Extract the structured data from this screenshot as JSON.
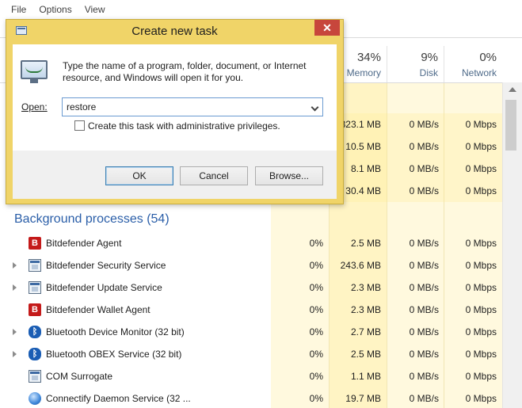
{
  "menubar": {
    "items": [
      "File",
      "Options",
      "View"
    ]
  },
  "columns": {
    "memory": {
      "percent": "34%",
      "label": "Memory"
    },
    "disk": {
      "percent": "9%",
      "label": "Disk"
    },
    "network": {
      "percent": "0%",
      "label": "Network"
    }
  },
  "app_rows": [
    {
      "memory": "323.1 MB",
      "disk": "0 MB/s",
      "network": "0 Mbps"
    },
    {
      "memory": "10.5 MB",
      "disk": "0 MB/s",
      "network": "0 Mbps"
    },
    {
      "memory": "8.1 MB",
      "disk": "0 MB/s",
      "network": "0 Mbps"
    },
    {
      "memory": "30.4 MB",
      "disk": "0 MB/s",
      "network": "0 Mbps"
    }
  ],
  "background": {
    "title": "Background processes (54)",
    "processes": [
      {
        "name": "Bitdefender Agent",
        "icon": "bitdefender-icon",
        "expandable": false,
        "cpu": "0%",
        "memory": "2.5 MB",
        "disk": "0 MB/s",
        "network": "0 Mbps"
      },
      {
        "name": "Bitdefender Security Service",
        "icon": "service-window-icon",
        "expandable": true,
        "cpu": "0%",
        "memory": "243.6 MB",
        "disk": "0 MB/s",
        "network": "0 Mbps"
      },
      {
        "name": "Bitdefender Update Service",
        "icon": "service-window-icon",
        "expandable": true,
        "cpu": "0%",
        "memory": "2.3 MB",
        "disk": "0 MB/s",
        "network": "0 Mbps"
      },
      {
        "name": "Bitdefender Wallet Agent",
        "icon": "bitdefender-icon",
        "expandable": false,
        "cpu": "0%",
        "memory": "2.3 MB",
        "disk": "0 MB/s",
        "network": "0 Mbps"
      },
      {
        "name": "Bluetooth Device Monitor (32 bit)",
        "icon": "bluetooth-icon",
        "expandable": true,
        "cpu": "0%",
        "memory": "2.7 MB",
        "disk": "0 MB/s",
        "network": "0 Mbps"
      },
      {
        "name": "Bluetooth OBEX Service (32 bit)",
        "icon": "bluetooth-icon",
        "expandable": true,
        "cpu": "0%",
        "memory": "2.5 MB",
        "disk": "0 MB/s",
        "network": "0 Mbps"
      },
      {
        "name": "COM Surrogate",
        "icon": "service-window-icon",
        "expandable": false,
        "cpu": "0%",
        "memory": "1.1 MB",
        "disk": "0 MB/s",
        "network": "0 Mbps"
      },
      {
        "name": "Connectify Daemon Service (32 ...",
        "icon": "globe-icon",
        "expandable": false,
        "cpu": "0%",
        "memory": "19.7 MB",
        "disk": "0 MB/s",
        "network": "0 Mbps"
      }
    ]
  },
  "dialog": {
    "title": "Create new task",
    "close_glyph": "✕",
    "description": "Type the name of a program, folder, document, or Internet resource, and Windows will open it for you.",
    "open_label": "Open:",
    "open_value": "restore",
    "admin_checkbox_label": "Create this task with administrative privileges.",
    "admin_checked": false,
    "ok_label": "OK",
    "cancel_label": "Cancel",
    "browse_label": "Browse..."
  }
}
